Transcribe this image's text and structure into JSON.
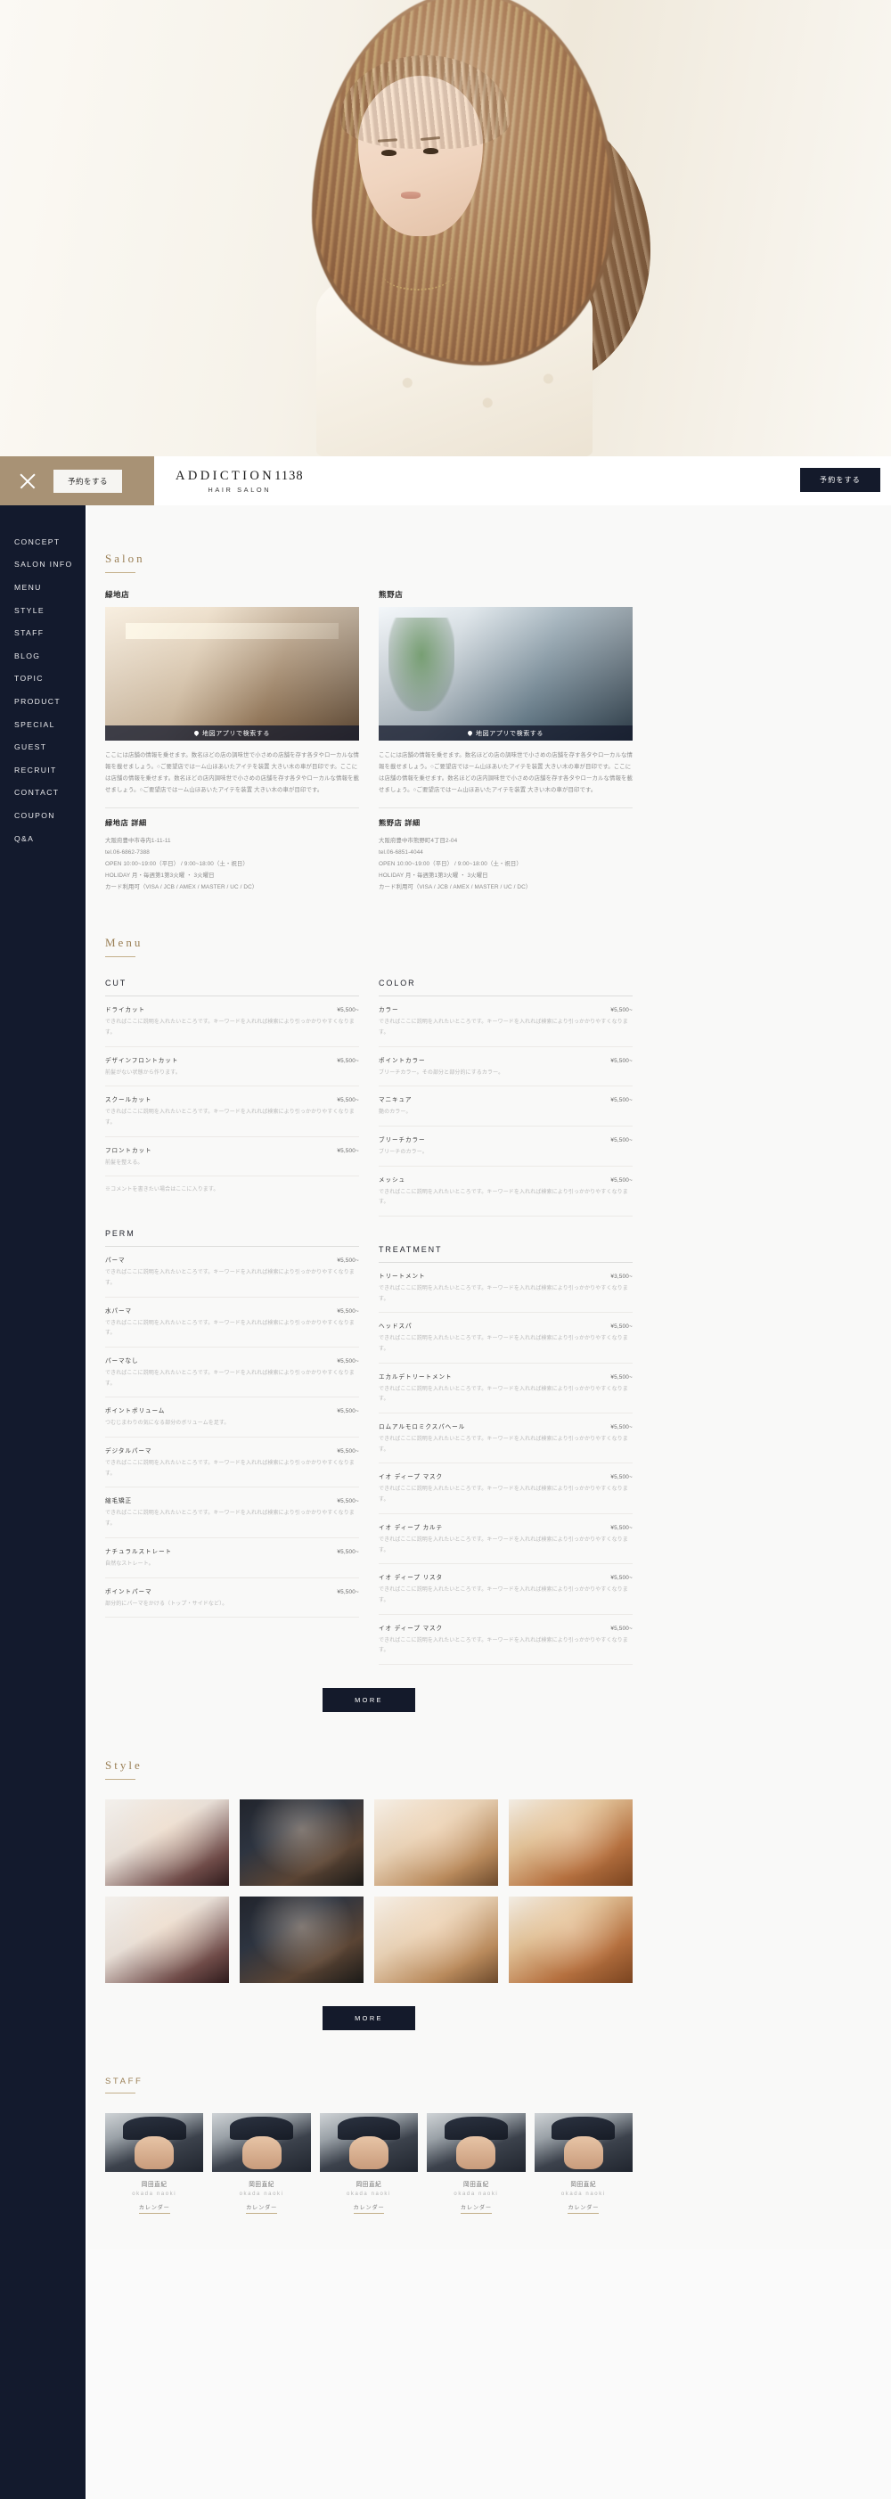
{
  "header": {
    "close_icon": "close-icon",
    "reserve_small_label": "予約をする",
    "brand_name": "ADDICTION",
    "brand_number": "1138",
    "brand_sub": "HAIR SALON",
    "reserve_dark_label": "予約をする"
  },
  "sidebar": {
    "items": [
      {
        "label": "CONCEPT"
      },
      {
        "label": "SALON INFO"
      },
      {
        "label": "MENU"
      },
      {
        "label": "STYLE"
      },
      {
        "label": "STAFF"
      },
      {
        "label": "BLOG"
      },
      {
        "label": "TOPIC"
      },
      {
        "label": "PRODUCT"
      },
      {
        "label": "SPECIAL"
      },
      {
        "label": "GUEST"
      },
      {
        "label": "RECRUIT"
      },
      {
        "label": "CONTACT"
      },
      {
        "label": "COUPON"
      },
      {
        "label": "Q&A"
      }
    ]
  },
  "salon": {
    "heading": "Salon",
    "map_button_label": "地図アプリで検索する",
    "shops": [
      {
        "name": "緑地店",
        "description": "ここには店舗の情報を乗せます。数名ほどの店の調味世で小さめの店舗を存す各タやロ一カルな情報を載せましょう。○ご要望店ではーム山ほあいたアイテを装置 大きい木の車が目印です。ここには店舗の情報を乗せます。数名ほどの店内調味世で小さめの店舗を存す各タやローカルな情報を載せましょう。○ご要望店ではーム山ほあいたアイテを装置 大きい木の車が目印です。",
        "detail_title": "緑地店 詳細",
        "details": [
          "大阪府豊中市寺内1-11-11",
          "tel.06-6862-7388",
          "OPEN 10:00~19:00（平日） / 9:00~18:00（土・祝日）",
          "HOLIDAY 月・毎週第1第3火曜 ・ 3火曜日",
          "カード利用可（VISA / JCB / AMEX / MASTER / UC / DC）"
        ]
      },
      {
        "name": "熊野店",
        "description": "ここには店舗の情報を乗せます。数名ほどの店の調味世で小さめの店舗を存す各タやロ一カルな情報を載せましょう。○ご要望店ではーム山ほあいたアイテを装置 大きい木の車が目印です。ここには店舗の情報を乗せます。数名ほどの店内調味世で小さめの店舗を存す各タやローカルな情報を載せましょう。○ご要望店ではーム山ほあいたアイテを装置 大きい木の車が目印です。",
        "detail_title": "熊野店 詳細",
        "details": [
          "大阪府豊中市熊野町4丁目2-04",
          "tel.06-6851-4044",
          "OPEN 10:00~19:00（平日） / 9:00~18:00（土・祝日）",
          "HOLIDAY 月・毎週第1第3火曜 ・ 3火曜日",
          "カード利用可（VISA / JCB / AMEX / MASTER / UC / DC）"
        ]
      }
    ]
  },
  "menu": {
    "heading": "Menu",
    "more_label": "MORE",
    "categories": [
      {
        "name": "CUT",
        "column": "left",
        "items": [
          {
            "name": "ドライカット",
            "price": "¥5,500~",
            "desc": "できればここに説明を入れたいところです。キーワードを入れれば検索により引っかかりやすくなります。"
          },
          {
            "name": "デザインフロントカット",
            "price": "¥5,500~",
            "desc": "前髪がない状態から作ります。"
          },
          {
            "name": "スクールカット",
            "price": "¥5,500~",
            "desc": "できればここに説明を入れたいところです。キーワードを入れれば検索により引っかかりやすくなります。"
          },
          {
            "name": "フロントカット",
            "price": "¥5,500~",
            "desc": "前髪を整える。"
          }
        ],
        "note": "※コメントを書きたい場合はここに入ります。"
      },
      {
        "name": "PERM",
        "column": "left",
        "items": [
          {
            "name": "パーマ",
            "price": "¥5,500~",
            "desc": "できればここに説明を入れたいところです。キーワードを入れれば検索により引っかかりやすくなります。"
          },
          {
            "name": "水パーマ",
            "price": "¥5,500~",
            "desc": "できればここに説明を入れたいところです。キーワードを入れれば検索により引っかかりやすくなります。"
          },
          {
            "name": "パーマなし",
            "price": "¥5,500~",
            "desc": "できればここに説明を入れたいところです。キーワードを入れれば検索により引っかかりやすくなります。"
          },
          {
            "name": "ポイントボリューム",
            "price": "¥5,500~",
            "desc": "つむじまわりの気になる部分のボリュームを足す。"
          },
          {
            "name": "デジタルパーマ",
            "price": "¥5,500~",
            "desc": "できればここに説明を入れたいところです。キーワードを入れれば検索により引っかかりやすくなります。"
          },
          {
            "name": "縮毛矯正",
            "price": "¥5,500~",
            "desc": "できればここに説明を入れたいところです。キーワードを入れれば検索により引っかかりやすくなります。"
          },
          {
            "name": "ナチュラルストレート",
            "price": "¥5,500~",
            "desc": "自然なストレート。"
          },
          {
            "name": "ポイントパーマ",
            "price": "¥5,500~",
            "desc": "部分的にパーマをかける（トップ・サイドなど）。"
          }
        ]
      },
      {
        "name": "COLOR",
        "column": "right",
        "items": [
          {
            "name": "カラー",
            "price": "¥5,500~",
            "desc": "できればここに説明を入れたいところです。キーワードを入れれば検索により引っかかりやすくなります。"
          },
          {
            "name": "ポイントカラー",
            "price": "¥5,500~",
            "desc": "ブリーチカラー。その部分と部分的にするカラー。"
          },
          {
            "name": "マニキュア",
            "price": "¥5,500~",
            "desc": "艶のカラー。"
          },
          {
            "name": "ブリーチカラー",
            "price": "¥5,500~",
            "desc": "ブリーチのカラー。"
          },
          {
            "name": "メッシュ",
            "price": "¥5,500~",
            "desc": "できればここに説明を入れたいところです。キーワードを入れれば検索により引っかかりやすくなります。"
          }
        ]
      },
      {
        "name": "TREATMENT",
        "column": "right",
        "items": [
          {
            "name": "トリートメント",
            "price": "¥3,500~",
            "desc": "できればここに説明を入れたいところです。キーワードを入れれば検索により引っかかりやすくなります。"
          },
          {
            "name": "ヘッドスパ",
            "price": "¥5,500~",
            "desc": "できればここに説明を入れたいところです。キーワードを入れれば検索により引っかかりやすくなります。"
          },
          {
            "name": "エカルデトリートメント",
            "price": "¥5,500~",
            "desc": "できればここに説明を入れたいところです。キーワードを入れれば検索により引っかかりやすくなります。"
          },
          {
            "name": "ロムアルモロミクスパヘール",
            "price": "¥5,500~",
            "desc": "できればここに説明を入れたいところです。キーワードを入れれば検索により引っかかりやすくなります。"
          },
          {
            "name": "イオ ディープ マスク",
            "price": "¥5,500~",
            "desc": "できればここに説明を入れたいところです。キーワードを入れれば検索により引っかかりやすくなります。"
          },
          {
            "name": "イオ ディープ カルテ",
            "price": "¥5,500~",
            "desc": "できればここに説明を入れたいところです。キーワードを入れれば検索により引っかかりやすくなります。"
          },
          {
            "name": "イオ ディープ リスタ",
            "price": "¥5,500~",
            "desc": "できればここに説明を入れたいところです。キーワードを入れれば検索により引っかかりやすくなります。"
          },
          {
            "name": "イオ ディープ マスク",
            "price": "¥5,500~",
            "desc": "できればここに説明を入れたいところです。キーワードを入れれば検索により引っかかりやすくなります。"
          }
        ]
      }
    ]
  },
  "style": {
    "heading": "Style",
    "more_label": "MORE",
    "cards": [
      {
        "id": "s1"
      },
      {
        "id": "s2"
      },
      {
        "id": "s3"
      },
      {
        "id": "s4"
      },
      {
        "id": "s1"
      },
      {
        "id": "s2"
      },
      {
        "id": "s3"
      },
      {
        "id": "s4"
      }
    ]
  },
  "staff": {
    "heading": "STAFF",
    "members": [
      {
        "jp": "岡田直紀",
        "en": "okada naoki",
        "calendar": "カレンダー"
      },
      {
        "jp": "岡田直紀",
        "en": "okada naoki",
        "calendar": "カレンダー"
      },
      {
        "jp": "岡田直紀",
        "en": "okada naoki",
        "calendar": "カレンダー"
      },
      {
        "jp": "岡田直紀",
        "en": "okada naoki",
        "calendar": "カレンダー"
      },
      {
        "jp": "岡田直紀",
        "en": "okada naoki",
        "calendar": "カレンダー"
      }
    ]
  },
  "colors": {
    "navy": "#131a2d",
    "gold": "#9a7f55",
    "tan": "#a89275",
    "bg": "#f9f9f8"
  }
}
